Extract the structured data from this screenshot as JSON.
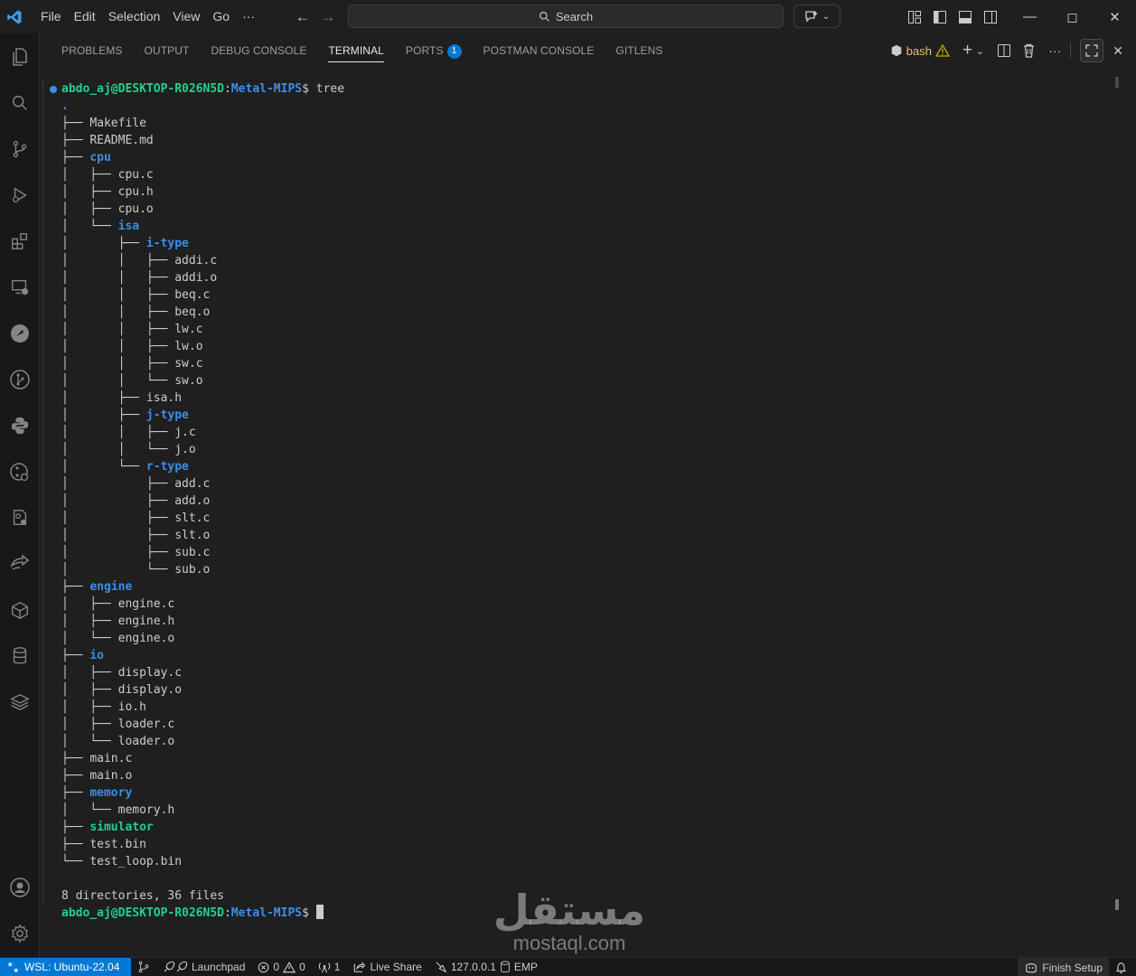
{
  "titlebar": {
    "menu": [
      "File",
      "Edit",
      "Selection",
      "View",
      "Go",
      "···"
    ],
    "search_placeholder": "Search"
  },
  "panel": {
    "tabs": [
      {
        "label": "PROBLEMS"
      },
      {
        "label": "OUTPUT"
      },
      {
        "label": "DEBUG CONSOLE"
      },
      {
        "label": "TERMINAL",
        "active": true
      },
      {
        "label": "PORTS",
        "badge": "1"
      },
      {
        "label": "POSTMAN CONSOLE"
      },
      {
        "label": "GITLENS"
      }
    ],
    "terminal_name": "bash"
  },
  "terminal": {
    "prompt_user": "abdo_aj@DESKTOP-R026N5D",
    "prompt_path": "Metal-MIPS",
    "command": "tree",
    "root": ".",
    "tree": [
      {
        "prefix": "├── ",
        "name": "Makefile",
        "type": "file"
      },
      {
        "prefix": "├── ",
        "name": "README.md",
        "type": "file"
      },
      {
        "prefix": "├── ",
        "name": "cpu",
        "type": "dir"
      },
      {
        "prefix": "│   ├── ",
        "name": "cpu.c",
        "type": "file"
      },
      {
        "prefix": "│   ├── ",
        "name": "cpu.h",
        "type": "file"
      },
      {
        "prefix": "│   ├── ",
        "name": "cpu.o",
        "type": "file"
      },
      {
        "prefix": "│   └── ",
        "name": "isa",
        "type": "dir"
      },
      {
        "prefix": "│       ├── ",
        "name": "i-type",
        "type": "dir"
      },
      {
        "prefix": "│       │   ├── ",
        "name": "addi.c",
        "type": "file"
      },
      {
        "prefix": "│       │   ├── ",
        "name": "addi.o",
        "type": "file"
      },
      {
        "prefix": "│       │   ├── ",
        "name": "beq.c",
        "type": "file"
      },
      {
        "prefix": "│       │   ├── ",
        "name": "beq.o",
        "type": "file"
      },
      {
        "prefix": "│       │   ├── ",
        "name": "lw.c",
        "type": "file"
      },
      {
        "prefix": "│       │   ├── ",
        "name": "lw.o",
        "type": "file"
      },
      {
        "prefix": "│       │   ├── ",
        "name": "sw.c",
        "type": "file"
      },
      {
        "prefix": "│       │   └── ",
        "name": "sw.o",
        "type": "file"
      },
      {
        "prefix": "│       ├── ",
        "name": "isa.h",
        "type": "file"
      },
      {
        "prefix": "│       ├── ",
        "name": "j-type",
        "type": "dir"
      },
      {
        "prefix": "│       │   ├── ",
        "name": "j.c",
        "type": "file"
      },
      {
        "prefix": "│       │   └── ",
        "name": "j.o",
        "type": "file"
      },
      {
        "prefix": "│       └── ",
        "name": "r-type",
        "type": "dir"
      },
      {
        "prefix": "│           ├── ",
        "name": "add.c",
        "type": "file"
      },
      {
        "prefix": "│           ├── ",
        "name": "add.o",
        "type": "file"
      },
      {
        "prefix": "│           ├── ",
        "name": "slt.c",
        "type": "file"
      },
      {
        "prefix": "│           ├── ",
        "name": "slt.o",
        "type": "file"
      },
      {
        "prefix": "│           ├── ",
        "name": "sub.c",
        "type": "file"
      },
      {
        "prefix": "│           └── ",
        "name": "sub.o",
        "type": "file"
      },
      {
        "prefix": "├── ",
        "name": "engine",
        "type": "dir"
      },
      {
        "prefix": "│   ├── ",
        "name": "engine.c",
        "type": "file"
      },
      {
        "prefix": "│   ├── ",
        "name": "engine.h",
        "type": "file"
      },
      {
        "prefix": "│   └── ",
        "name": "engine.o",
        "type": "file"
      },
      {
        "prefix": "├── ",
        "name": "io",
        "type": "dir"
      },
      {
        "prefix": "│   ├── ",
        "name": "display.c",
        "type": "file"
      },
      {
        "prefix": "│   ├── ",
        "name": "display.o",
        "type": "file"
      },
      {
        "prefix": "│   ├── ",
        "name": "io.h",
        "type": "file"
      },
      {
        "prefix": "│   ├── ",
        "name": "loader.c",
        "type": "file"
      },
      {
        "prefix": "│   └── ",
        "name": "loader.o",
        "type": "file"
      },
      {
        "prefix": "├── ",
        "name": "main.c",
        "type": "file"
      },
      {
        "prefix": "├── ",
        "name": "main.o",
        "type": "file"
      },
      {
        "prefix": "├── ",
        "name": "memory",
        "type": "dir"
      },
      {
        "prefix": "│   └── ",
        "name": "memory.h",
        "type": "file"
      },
      {
        "prefix": "├── ",
        "name": "simulator",
        "type": "exe"
      },
      {
        "prefix": "├── ",
        "name": "test.bin",
        "type": "file"
      },
      {
        "prefix": "└── ",
        "name": "test_loop.bin",
        "type": "file"
      }
    ],
    "summary": "8 directories, 36 files"
  },
  "watermark": {
    "arabic": "مستقل",
    "latin": "mostaql.com"
  },
  "statusbar": {
    "remote": "WSL: Ubuntu-22.04",
    "launchpad": "Launchpad",
    "errors": "0",
    "warnings": "0",
    "ports": "1",
    "live_share": "Live Share",
    "host": "127.0.0.1",
    "db": "EMP",
    "finish_setup": "Finish Setup"
  },
  "colors": {
    "accent": "#0078d4",
    "dir": "#3b8eea",
    "exe": "#23d18b"
  }
}
